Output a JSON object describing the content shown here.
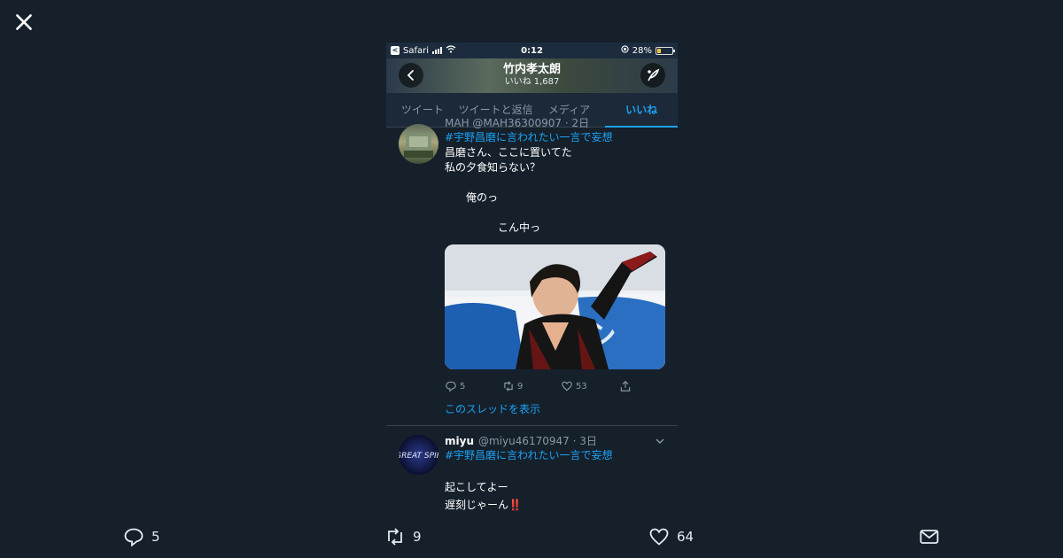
{
  "lightbox": {
    "close_icon": "close-icon",
    "reply_count": "5",
    "retweet_count": "9",
    "like_count": "64"
  },
  "status_bar": {
    "app": "Safari",
    "time": "0:12",
    "battery": "28%",
    "battery_level": 0.28
  },
  "profile": {
    "name": "竹内孝太朗",
    "likes_line": "いいね 1,687"
  },
  "tabs": [
    {
      "label": "ツイート",
      "active": false
    },
    {
      "label": "ツイートと返信",
      "active": false
    },
    {
      "label": "メディア",
      "active": false
    },
    {
      "label": "いいね",
      "active": true
    }
  ],
  "tweets": [
    {
      "header": "MAH @MAH36300907 · 2日",
      "hashtag": "#宇野昌磨に言われたい一言で妄想",
      "text_lines": [
        "昌磨さん、ここに置いてた",
        "私の夕食知らない？",
        "",
        "　　俺のっ",
        "",
        "　　　　　こん中っ"
      ],
      "replies": "5",
      "retweets": "9",
      "likes": "53",
      "thread_link": "このスレッドを表示"
    },
    {
      "name": "miyu",
      "handle": "@miyu46170947 · 3日",
      "hashtag": "#宇野昌磨に言われたい一言で妄想",
      "text_lines": [
        "起こしてよー",
        "遅刻じゃーん‼️"
      ],
      "avatar_text": "GREAT SPIR"
    }
  ],
  "colors": {
    "background": "#15202b",
    "accent": "#1da1f2",
    "muted": "#8899a6"
  }
}
